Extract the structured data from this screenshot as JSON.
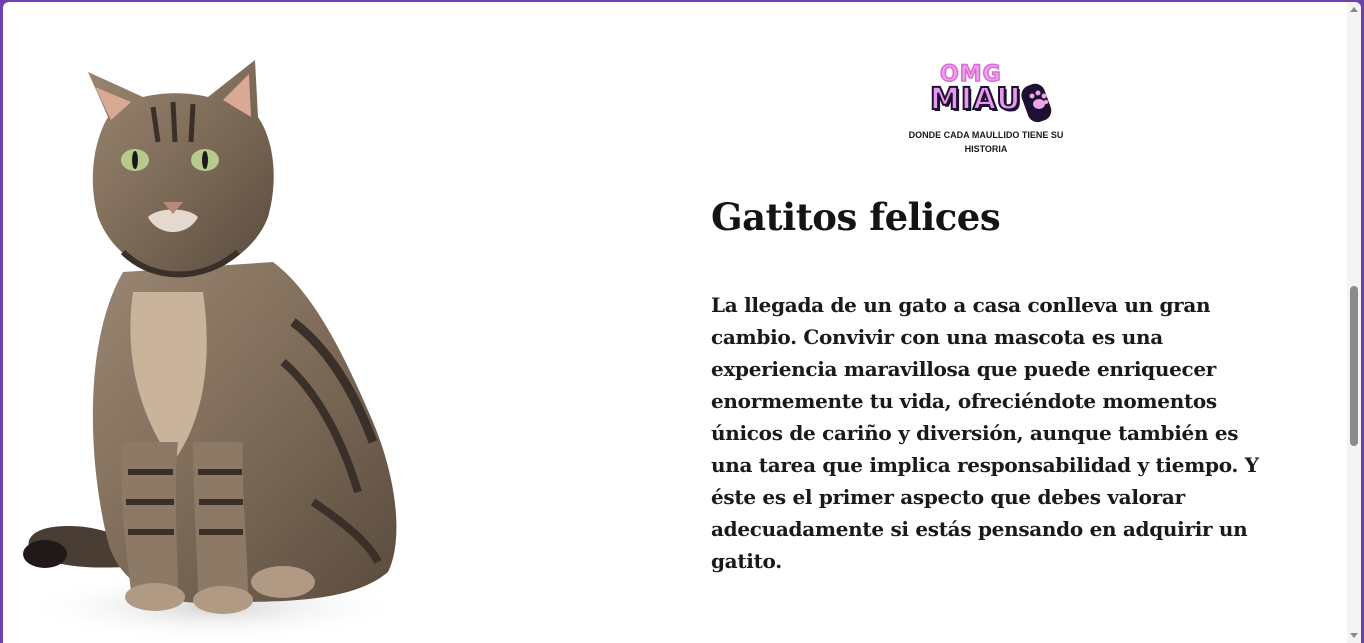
{
  "logo": {
    "line1": "OMG",
    "line2": "MIAU",
    "tagline": "DONDE CADA MAULLIDO TIENE SU HISTORIA",
    "colors": {
      "pink": "#e898f0",
      "outline": "#1d1030"
    }
  },
  "content": {
    "title": "Gatitos felices",
    "paragraph": "La llegada de un gato a casa conlleva un gran cambio. Convivir con una mascota es una experiencia maravillosa que puede enriquecer enormemente tu vida, ofreciéndote momentos únicos de cariño y diversión, aunque también es una tarea que implica responsabilidad y tiempo. Y éste es el primer aspecto que debes valorar adecuadamente si estás pensando en adquirir un gatito."
  },
  "image": {
    "icon": "tabby-cat-photo"
  },
  "theme": {
    "frame_border": "#6d3fb0",
    "background": "#ffffff",
    "text": "#141414"
  }
}
